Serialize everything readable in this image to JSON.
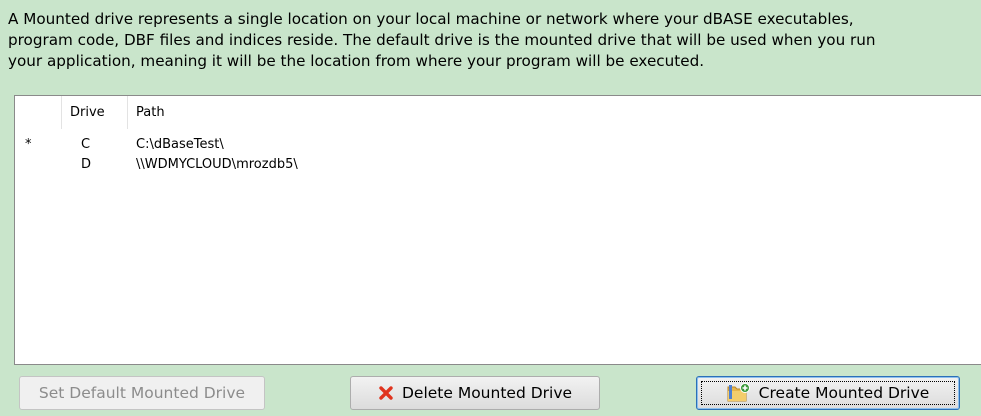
{
  "description": {
    "line1": "A Mounted drive represents a single location on your local machine or network where your dBASE executables,",
    "line2": "program code, DBF files and indices reside. The default drive is the mounted drive that will be used when you run",
    "line3": "your application, meaning it will be the location from where your program will be executed."
  },
  "grid": {
    "columns": [
      "",
      "Drive",
      "Path"
    ],
    "rows": [
      {
        "mark": "*",
        "drive": "C",
        "path": "C:\\dBaseTest\\"
      },
      {
        "mark": "",
        "drive": "D",
        "path": "\\\\WDMYCLOUD\\mrozdb5\\"
      }
    ]
  },
  "buttons": {
    "set_default": "Set Default Mounted Drive",
    "delete": "Delete Mounted Drive",
    "create": "Create Mounted Drive"
  },
  "icons": {
    "delete": "red-x-icon",
    "create": "folder-add-icon"
  },
  "colors": {
    "panel_bg": "#c9e5cb",
    "delete_icon": "#e0341e"
  }
}
